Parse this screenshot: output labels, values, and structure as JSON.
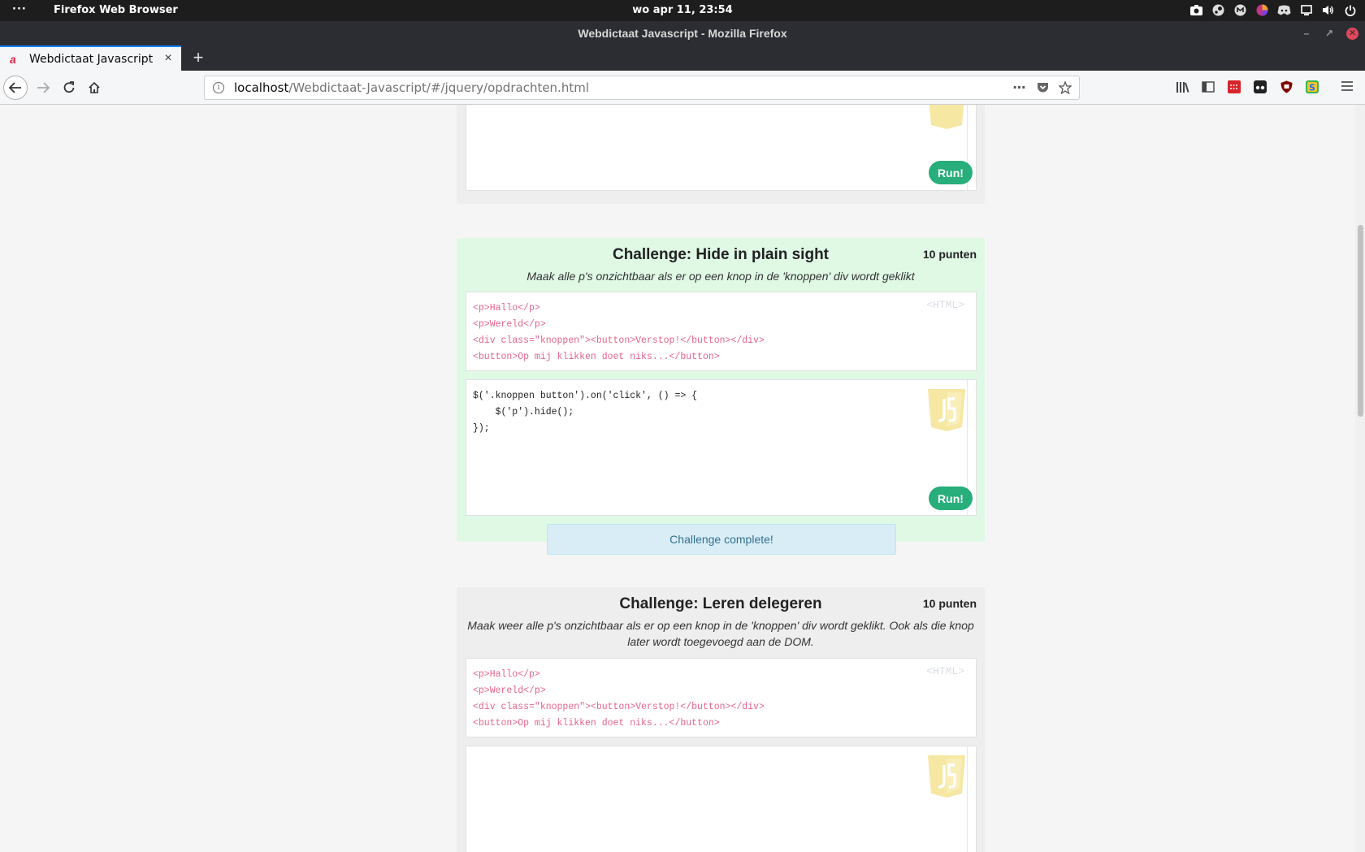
{
  "topbar": {
    "activities": "···",
    "app_name": "Firefox Web Browser",
    "clock": "wo apr 11, 23:54"
  },
  "window": {
    "title": "Webdictaat Javascript - Mozilla Firefox"
  },
  "tabs": [
    {
      "label": "Webdictaat Javascript",
      "favicon": "a"
    }
  ],
  "urlbar": {
    "host": "localhost",
    "path": "/Webdictaat-Javascript/#/jquery/opdrachten.html"
  },
  "colors": {
    "accent_blue": "#0a84ff",
    "run_button": "#27ae7a",
    "challenge_green": "#dff9e5",
    "challenge_gray": "#eeeeee",
    "html_code": "#e7648b",
    "complete_bg": "#d9edf7",
    "complete_text": "#31708f"
  },
  "icons": {
    "tray": [
      "screenshot-icon",
      "steam-icon",
      "mail-icon",
      "color-picker-icon",
      "discord-icon",
      "window-icon",
      "volume-icon",
      "power-icon"
    ],
    "toolbar": [
      "library-icon",
      "sidebar-icon",
      "extension-red-icon",
      "extension-dark-icon",
      "ublock-icon",
      "extension-s-icon"
    ]
  },
  "page": {
    "prev_challenge": {
      "run_label": "Run!"
    },
    "challenge1": {
      "title": "Challenge: Hide in plain sight",
      "points": "10 punten",
      "description": "Maak alle p's onzichtbaar als er op een knop in de 'knoppen' div wordt geklikt",
      "html_tag": "<HTML>",
      "html_lines": [
        "<p>Hallo</p>",
        "<p>Wereld</p>",
        "<div class=\"knoppen\"><button>Verstop!</button></div>",
        "<button>Op mij klikken doet niks...</button>"
      ],
      "js_lines": [
        "$('.knoppen button').on('click', () => {",
        "    $('p').hide();",
        "});"
      ],
      "run_label": "Run!",
      "status": "Challenge complete!"
    },
    "challenge2": {
      "title": "Challenge: Leren delegeren",
      "points": "10 punten",
      "description": "Maak weer alle p's onzichtbaar als er op een knop in de 'knoppen' div wordt geklikt. Ook als die knop later wordt toegevoegd aan de DOM.",
      "html_tag": "<HTML>",
      "html_lines": [
        "<p>Hallo</p>",
        "<p>Wereld</p>",
        "<div class=\"knoppen\"><button>Verstop!</button></div>",
        "<button>Op mij klikken doet niks...</button>"
      ]
    }
  }
}
